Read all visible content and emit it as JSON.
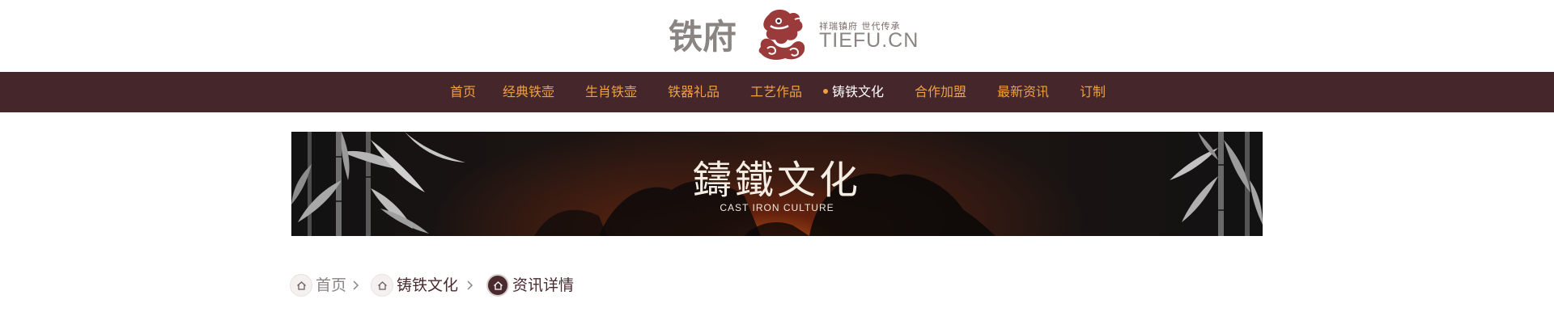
{
  "header": {
    "logo_cn": "铁府",
    "slogan": "祥瑞镇府 世代传承",
    "domain": "TIEFU.CN"
  },
  "nav": {
    "items": [
      {
        "label": "首页"
      },
      {
        "label": "经典铁壶"
      },
      {
        "label": "生肖铁壶"
      },
      {
        "label": "铁器礼品"
      },
      {
        "label": "工艺作品"
      },
      {
        "label": "铸铁文化",
        "active": true
      },
      {
        "label": "合作加盟"
      },
      {
        "label": "最新资讯"
      },
      {
        "label": "订制"
      }
    ]
  },
  "banner": {
    "title": "鑄鐵文化",
    "subtitle": "CAST IRON CULTURE"
  },
  "breadcrumb": {
    "items": [
      {
        "label": "首页",
        "icon": "home-icon"
      },
      {
        "label": "铸铁文化",
        "icon": "home-icon"
      },
      {
        "label": "资讯详情",
        "icon": "home-icon",
        "current": true
      }
    ]
  },
  "colors": {
    "nav_background": "#45262a",
    "nav_text": "#f0a03f",
    "nav_active_text": "#ffffff",
    "logo_red": "#9a3a3a",
    "logo_gray": "#8a8583"
  }
}
